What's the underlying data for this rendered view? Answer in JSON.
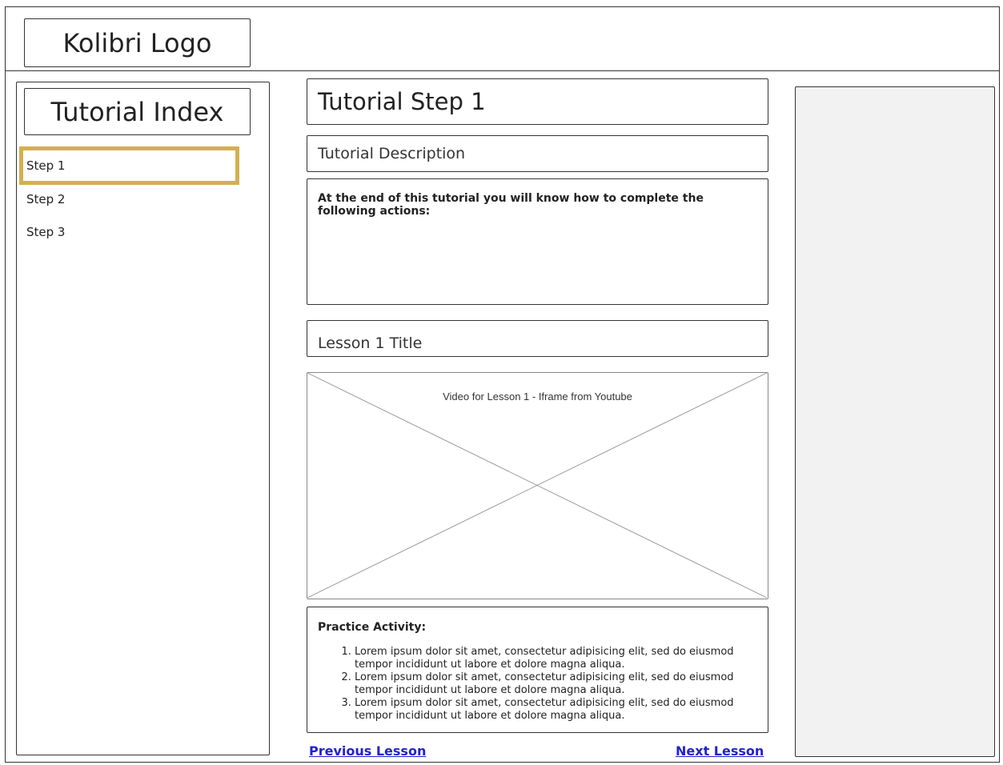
{
  "header": {
    "logo_text": "Kolibri Logo"
  },
  "sidebar": {
    "title": "Tutorial Index",
    "items": [
      {
        "label": "Step 1",
        "selected": true
      },
      {
        "label": "Step 2",
        "selected": false
      },
      {
        "label": "Step 3",
        "selected": false
      }
    ],
    "selected_color": "#d4af52"
  },
  "main": {
    "step_title": "Tutorial Step 1",
    "description_title": "Tutorial Description",
    "description_text": "At the end of this tutorial you will know how to complete the following actions:",
    "lesson_title": "Lesson 1 Title",
    "video_label": "Video for Lesson 1 - Iframe from Youtube",
    "practice": {
      "heading": "Practice Activity:",
      "items": [
        "Lorem ipsum dolor sit amet, consectetur adipisicing elit, sed do eiusmod tempor incididunt ut labore et dolore magna aliqua.",
        "Lorem ipsum dolor sit amet, consectetur adipisicing elit, sed do eiusmod tempor incididunt ut labore et dolore magna aliqua.",
        "Lorem ipsum dolor sit amet, consectetur adipisicing elit, sed do eiusmod tempor incididunt ut labore et dolore magna aliqua."
      ]
    },
    "nav": {
      "previous_label": "Previous Lesson",
      "next_label": "Next Lesson",
      "link_color": "#2222cc"
    }
  }
}
